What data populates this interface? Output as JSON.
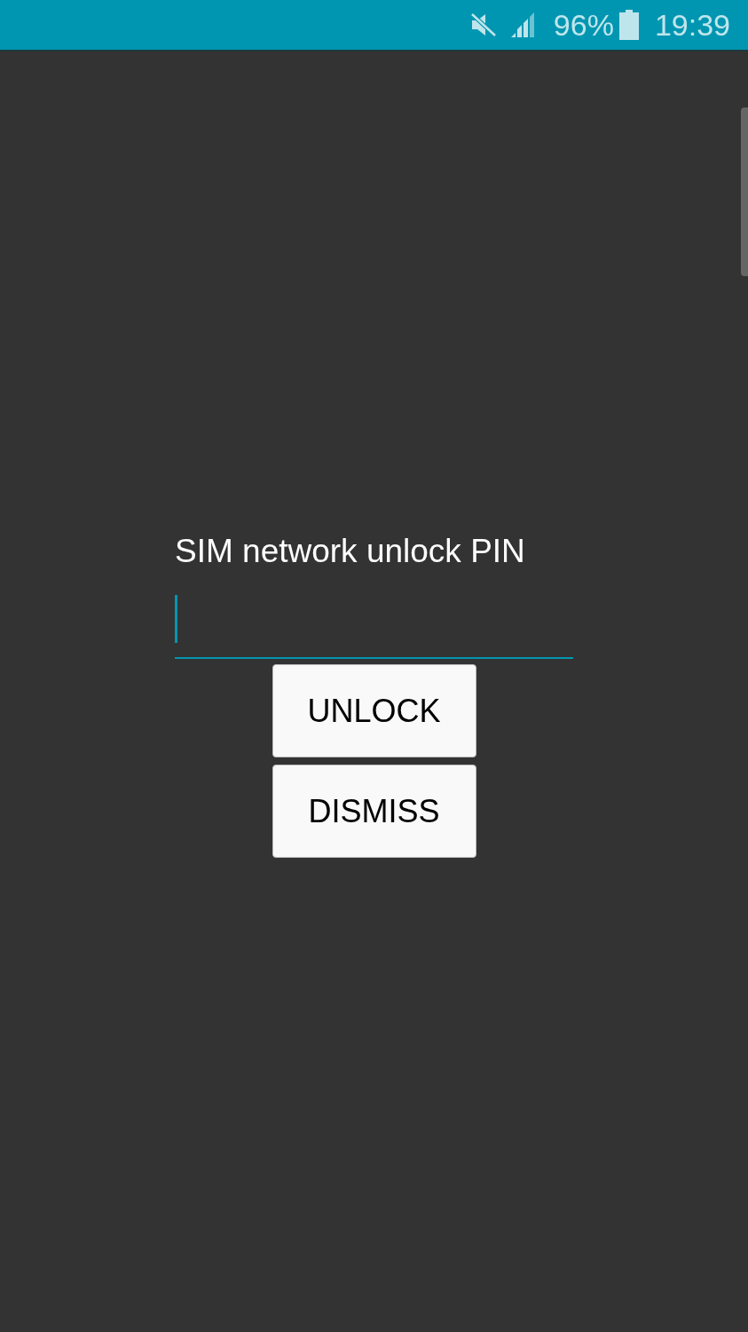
{
  "status_bar": {
    "battery": "96%",
    "time": "19:39"
  },
  "prompt": "SIM network unlock PIN",
  "pin_field": {
    "focused": true
  },
  "buttons": [
    "UNLOCK",
    "DISMISS"
  ]
}
